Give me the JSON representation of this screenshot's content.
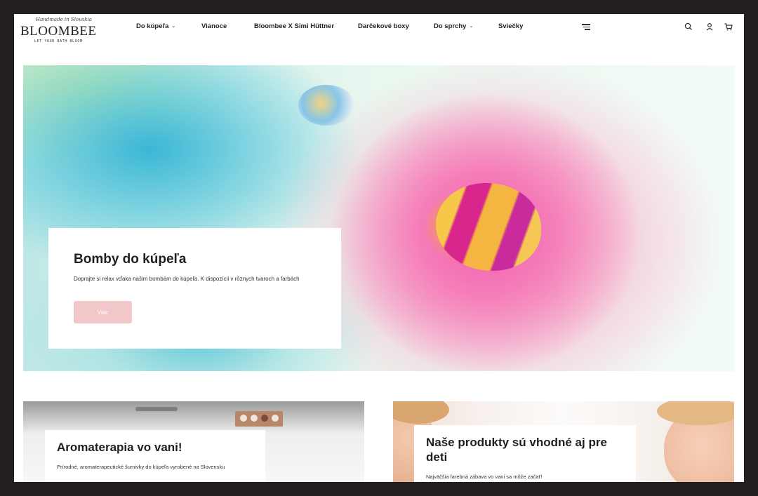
{
  "header": {
    "logo": {
      "tagline": "Handmade in Slovakia",
      "wordmark": "BLOOMBEE",
      "subtitle": "LET YOUR BATH BLOOM"
    },
    "nav": [
      {
        "label": "Do kúpeľa",
        "dropdown": true
      },
      {
        "label": "Vianoce",
        "dropdown": false
      },
      {
        "label": "Bloombee X Simi Hüttner",
        "dropdown": false
      },
      {
        "label": "Darčekové boxy",
        "dropdown": false
      },
      {
        "label": "Do sprchy",
        "dropdown": true
      },
      {
        "label": "Sviečky",
        "dropdown": false
      }
    ],
    "icons": [
      "menu-icon",
      "search-icon",
      "account-icon",
      "cart-icon"
    ]
  },
  "hero": {
    "title": "Bomby do kúpeľa",
    "text": "Doprajte si relax vďaka našim bombám do kúpeľa. K dispozícii v rôznych tvaroch a farbách",
    "button_label": "Viac",
    "button_color": "#f2c7c9"
  },
  "tiles": [
    {
      "title": "Aromaterapia vo vani!",
      "text": "Prírodné, aromaterapeutické šumivky do kúpeľa vyrobené na Slovensku"
    },
    {
      "title": "Naše produkty sú vhodné aj pre deti",
      "text": "Najväčšia farebná zábava vo vani sa môže začať!"
    }
  ],
  "colors": {
    "frame": "#231f20",
    "text": "#1f1f1f",
    "accent": "#f2c7c9"
  }
}
